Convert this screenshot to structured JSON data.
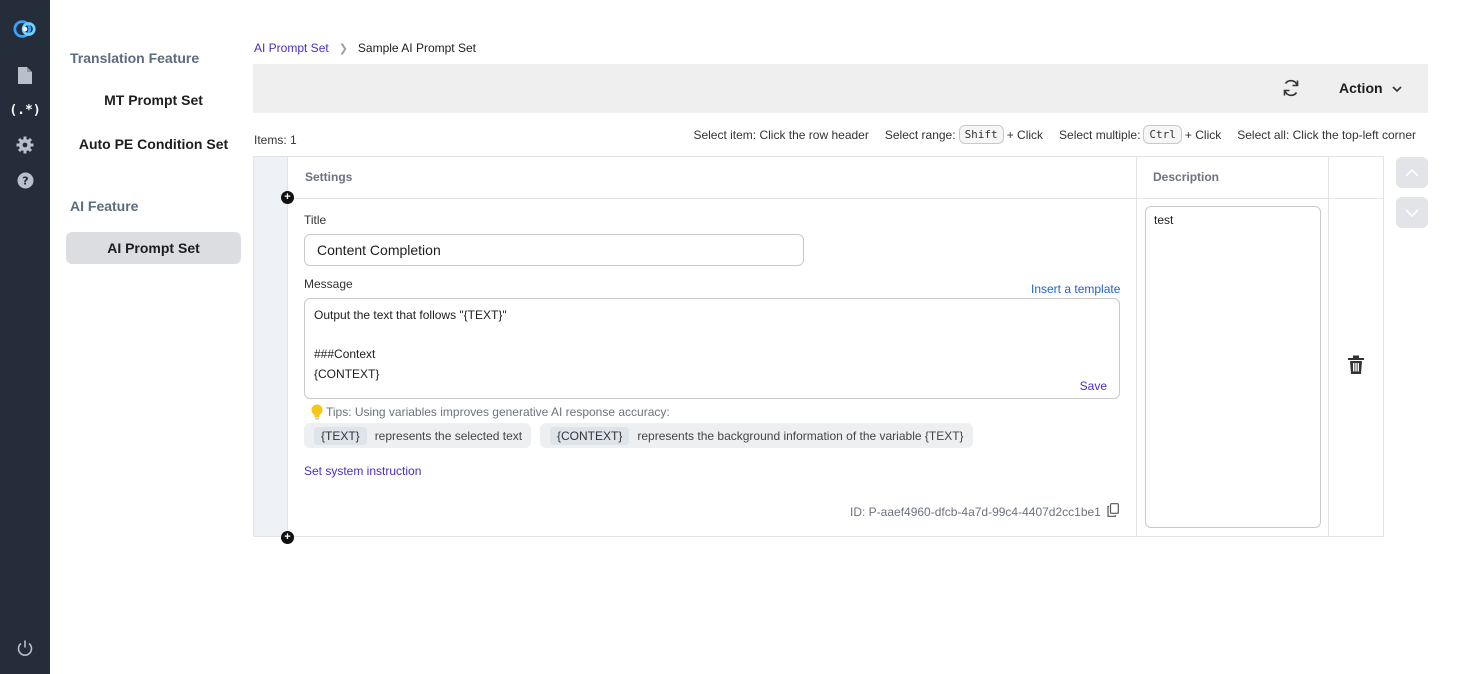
{
  "sidebar": {
    "groups": [
      {
        "label": "Translation Feature",
        "items": [
          "MT Prompt Set",
          "Auto PE Condition Set"
        ]
      },
      {
        "label": "AI Feature",
        "items": [
          "AI Prompt Set"
        ]
      }
    ],
    "active_item": "AI Prompt Set"
  },
  "breadcrumb": {
    "parent": "AI Prompt Set",
    "current": "Sample AI Prompt Set"
  },
  "toolbar": {
    "action_label": "Action"
  },
  "grid_info": {
    "items_count": "Items: 1",
    "hints": [
      {
        "text": "Select item: Click the row header"
      },
      {
        "prefix": "Select range:",
        "key": "Shift",
        "suffix": "+ Click"
      },
      {
        "prefix": "Select multiple:",
        "key": "Ctrl",
        "suffix": "+ Click"
      },
      {
        "text": "Select all: Click the top-left corner"
      }
    ]
  },
  "columns": {
    "settings": "Settings",
    "description": "Description"
  },
  "row": {
    "title_label": "Title",
    "title_value": "Content Completion",
    "message_label": "Message",
    "insert_template": "Insert a template",
    "message_lines": [
      "Output the text that follows \"{TEXT}\"",
      "",
      "###Context",
      "{CONTEXT}"
    ],
    "save_label": "Save",
    "tips_text": "Tips: Using variables improves generative AI response accuracy:",
    "variables": [
      {
        "name": "{TEXT}",
        "desc": "represents the selected text"
      },
      {
        "name": "{CONTEXT}",
        "desc": "represents the background information of the variable {TEXT}"
      }
    ],
    "system_instruction": "Set system instruction",
    "id_text": "ID: P-aaef4960-dfcb-4a7d-99c4-4407d2cc1be1",
    "description": "test"
  }
}
